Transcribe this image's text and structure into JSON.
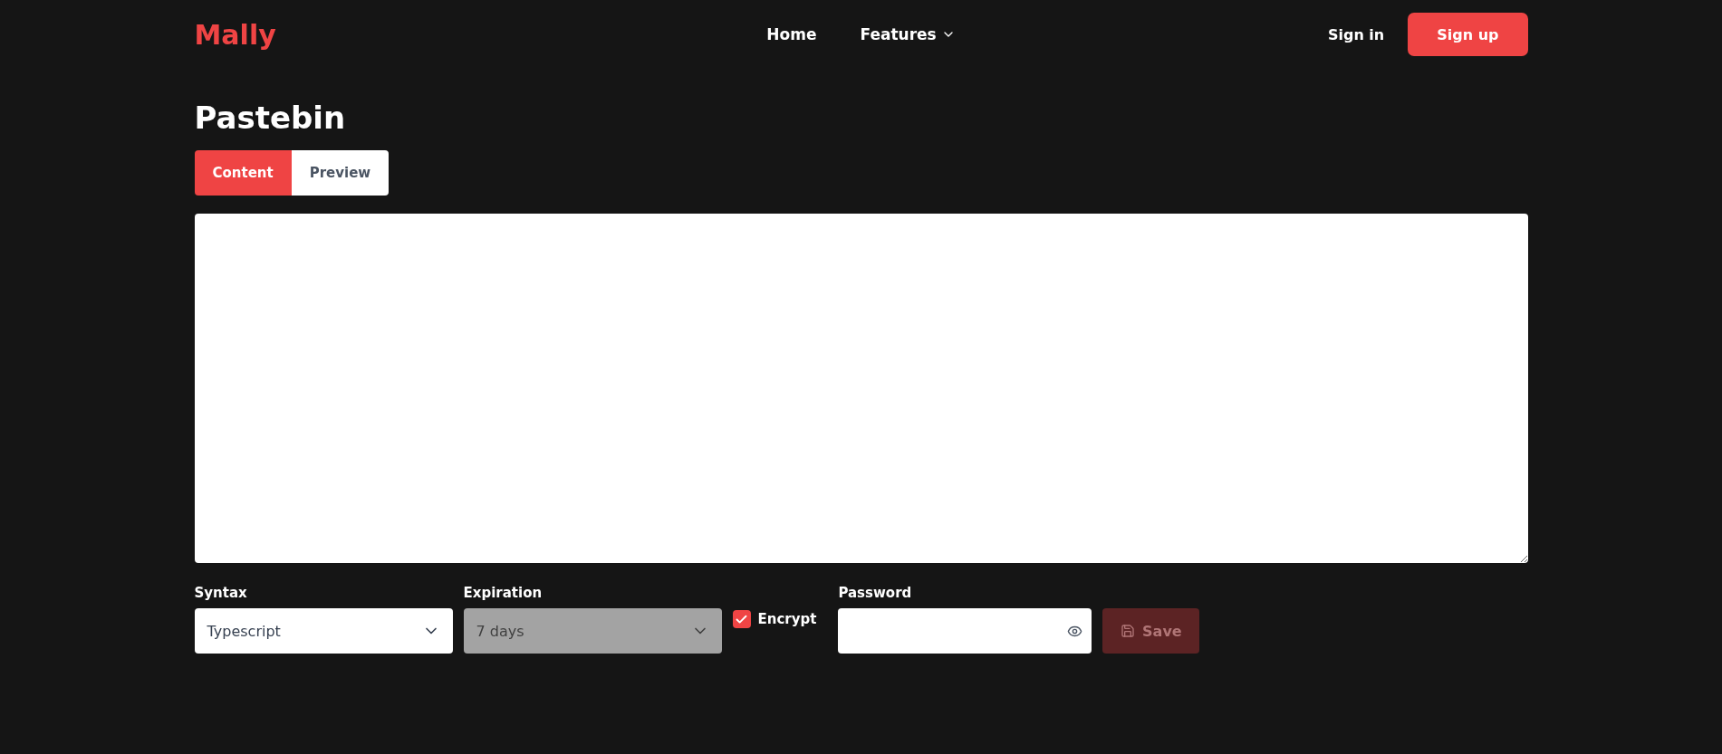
{
  "nav": {
    "logo": "Mally",
    "links": [
      {
        "label": "Home",
        "has_menu": false
      },
      {
        "label": "Features",
        "has_menu": true
      }
    ],
    "sign_in": "Sign in",
    "sign_up": "Sign up"
  },
  "title": "Pastebin",
  "tabs": [
    {
      "label": "Content",
      "selected": true
    },
    {
      "label": "Preview",
      "selected": false
    }
  ],
  "syntax": {
    "label": "Syntax",
    "value": "Typescript",
    "disabled": false
  },
  "expiration": {
    "label": "Expiration",
    "value": "7 days",
    "disabled": true
  },
  "encrypt": {
    "label": "Encrypt",
    "checked": true
  },
  "password": {
    "label": "Password"
  },
  "save": {
    "label": "Save",
    "disabled": true
  }
}
